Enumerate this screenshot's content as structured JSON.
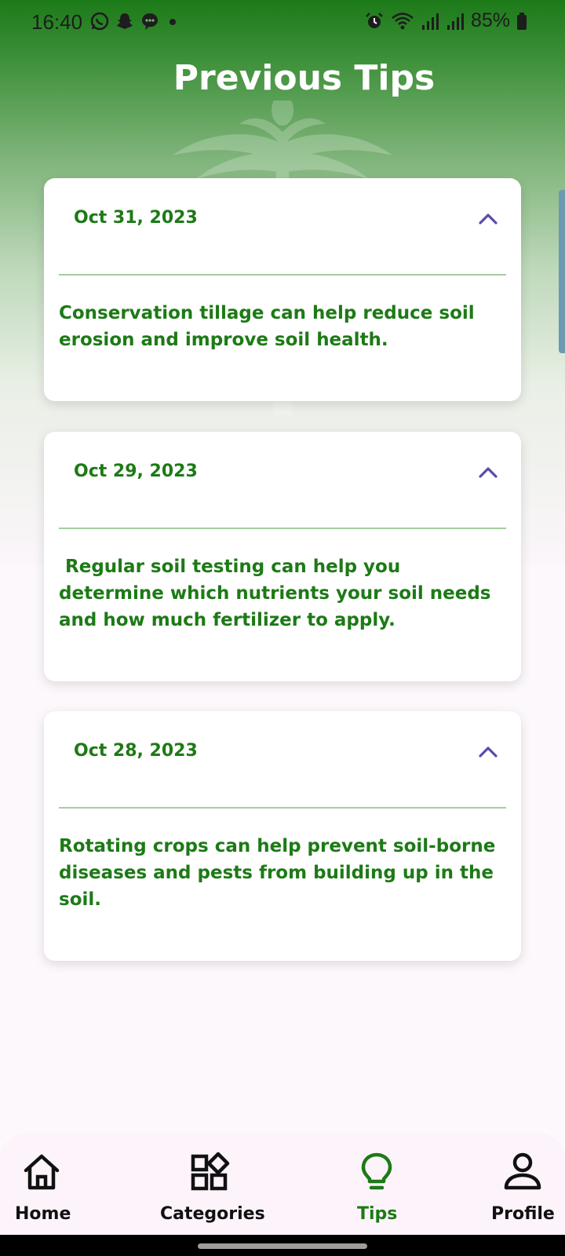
{
  "status_bar": {
    "time": "16:40",
    "battery": "85%",
    "icons": [
      "whatsapp-icon",
      "snapchat-icon",
      "messages-icon",
      "dot-icon",
      "alarm-icon",
      "wifi-icon",
      "signal-icon",
      "signal-icon",
      "battery-icon"
    ]
  },
  "page": {
    "title": "Previous Tips"
  },
  "tips": [
    {
      "date": "Oct 31, 2023",
      "text": "Conservation tillage can help reduce soil erosion and improve soil health.",
      "expanded": true
    },
    {
      "date": "Oct 29, 2023",
      "text": " Regular soil testing can help you determine which nutrients your soil needs and how much fertilizer to apply.",
      "expanded": true
    },
    {
      "date": "Oct 28, 2023",
      "text": "Rotating crops can help prevent soil-borne diseases and pests from building up in the soil.",
      "expanded": true
    }
  ],
  "bottom_nav": {
    "items": [
      {
        "label": "Home",
        "icon": "home-icon"
      },
      {
        "label": "Categories",
        "icon": "categories-icon"
      },
      {
        "label": "Tips",
        "icon": "lightbulb-icon",
        "active": true
      },
      {
        "label": "Profile",
        "icon": "profile-icon"
      }
    ]
  },
  "colors": {
    "primary_green": "#1d7a16",
    "header_green": "#1c7a18",
    "chevron_purple": "#5b4ba8",
    "divider": "#a6cda2"
  }
}
